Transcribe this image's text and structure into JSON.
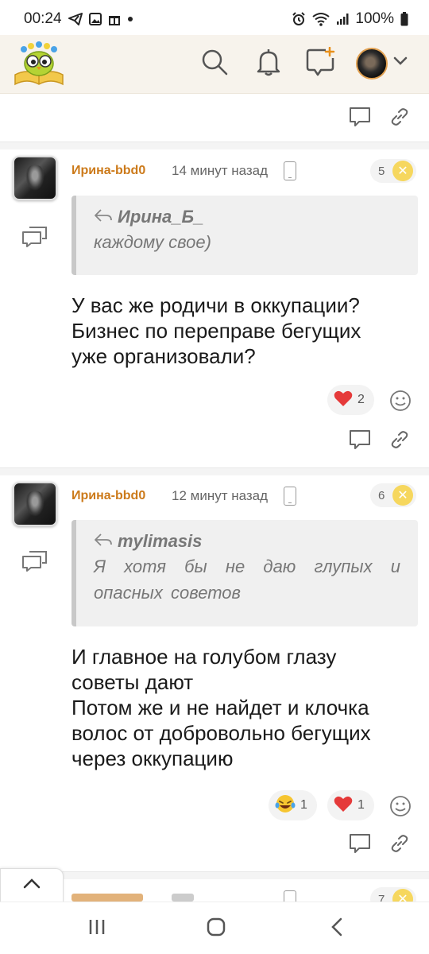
{
  "status_bar": {
    "time": "00:24",
    "battery": "100%",
    "icons": [
      "telegram-icon",
      "gallery-icon",
      "gift-icon",
      "dot-icon",
      "alarm-icon",
      "wifi-icon",
      "signal-icon",
      "battery-icon"
    ]
  },
  "header": {
    "logo": "owl-book-logo",
    "icons": [
      "search-icon",
      "bell-icon",
      "add-post-icon",
      "avatar",
      "chevron-down-icon"
    ]
  },
  "comments": [
    {
      "author": "Ирина-bbd0",
      "time": "14 минут назад",
      "counter": "5",
      "quote": {
        "author": "Ирина_Б_",
        "text": "каждому свое)"
      },
      "body": [
        "У вас же родичи в оккупации?",
        "Бизнес по переправе бегущих",
        "уже организовали?"
      ],
      "reactions": [
        {
          "emoji": "❤️",
          "count": "2"
        }
      ]
    },
    {
      "author": "Ирина-bbd0",
      "time": "12 минут назад",
      "counter": "6",
      "quote": {
        "author": "mylimasis",
        "text": "Я хотя бы не даю глупых и опасных советов"
      },
      "body": [
        "И главное на голубом глазу",
        "советы дают",
        "Потом же и не найдет и клочка",
        "волос от добровольно бегущих",
        "через оккупацию"
      ],
      "reactions": [
        {
          "emoji": "😂",
          "count": "1"
        },
        {
          "emoji": "❤️",
          "count": "1"
        }
      ]
    }
  ],
  "partial_comment": {
    "counter": "7"
  },
  "nav": {
    "icons": [
      "recent-apps-icon",
      "home-icon",
      "back-icon"
    ]
  }
}
